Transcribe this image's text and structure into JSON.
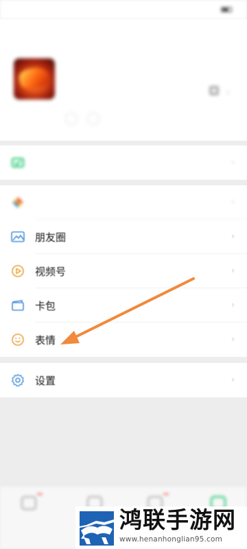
{
  "status_bar": {
    "time": "",
    "carrier": "",
    "right_text": ""
  },
  "profile": {
    "nickname": "",
    "wechat_id": "",
    "chips": [
      "",
      ""
    ]
  },
  "menu": {
    "services": {
      "label": ""
    },
    "favorites": {
      "label": ""
    },
    "moments": {
      "label": "朋友圈"
    },
    "channels": {
      "label": "视频号"
    },
    "cards": {
      "label": "卡包"
    },
    "stickers": {
      "label": "表情"
    },
    "settings": {
      "label": "设置"
    }
  },
  "colors": {
    "accent_arrow": "#f08a3c",
    "icon_blue": "#4a90d9",
    "icon_orange": "#e5a23a",
    "icon_green": "#07c160"
  },
  "bottom_tabs": [
    {
      "label": "",
      "badge": ""
    },
    {
      "label": ""
    },
    {
      "label": "",
      "badge": ""
    },
    {
      "label": ""
    }
  ],
  "watermark": {
    "title": "鸿联手游网",
    "url": "www.henanhonglian95.com"
  }
}
